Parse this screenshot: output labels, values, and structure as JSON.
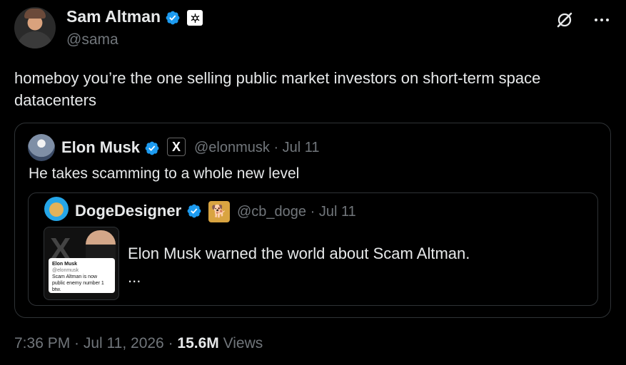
{
  "author": {
    "name": "Sam Altman",
    "handle": "@sama",
    "avatar_icon": "sam-altman-avatar"
  },
  "tweet": {
    "text": "homeboy you’re the one selling public market investors on short-term space datacenters"
  },
  "quoted_tweet": {
    "name": "Elon Musk",
    "handle_date": "@elonmusk · Jul 11",
    "affiliation_label": "X",
    "text": "He takes scamming to a whole new level"
  },
  "nested_quote": {
    "name": "DogeDesigner",
    "handle_date": "@cb_doge · Jul 11",
    "text": "Elon Musk warned the world about Scam Altman.",
    "more": "...",
    "media": {
      "card_name": "Elon Musk",
      "card_handle": "@elonmusk",
      "card_text": "Scam Altman is now public enemy number 1 btw."
    }
  },
  "footer": {
    "time_date": "7:36 PM · Jul 11, 2026 · ",
    "views_count": "15.6M",
    "views_label": " Views"
  },
  "colors": {
    "background": "#000000",
    "text": "#e7e9ea",
    "muted": "#71767b",
    "verified": "#1d9bf0",
    "border": "#2f3336"
  },
  "icons": [
    "verified-badge-icon",
    "openai-logo-icon",
    "grok-icon",
    "more-icon",
    "x-logo-icon",
    "doge-icon"
  ]
}
